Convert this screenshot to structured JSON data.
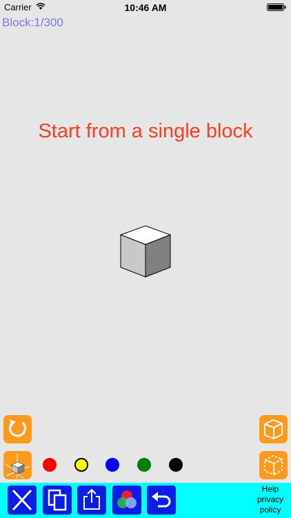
{
  "status_bar": {
    "carrier": "Carrier",
    "time": "10:46 AM"
  },
  "block_counter": "Block:1/300",
  "headline": "Start from a single block",
  "colors": {
    "accent": "#ff9a1f",
    "toolbar_bg": "#00ffff",
    "toolbar_button": "#0a1ee6",
    "headline": "#ff3b1f"
  },
  "palette": [
    {
      "name": "red",
      "color": "#ff0000",
      "selected": false
    },
    {
      "name": "yellow",
      "color": "#ffff00",
      "selected": true
    },
    {
      "name": "blue",
      "color": "#0000ff",
      "selected": false
    },
    {
      "name": "green",
      "color": "#008000",
      "selected": false
    },
    {
      "name": "black",
      "color": "#000000",
      "selected": false
    }
  ],
  "links": {
    "help": "Help",
    "privacy_line1": "privacy",
    "privacy_line2": "policy"
  },
  "icons": {
    "rotate": "rotate-icon",
    "view_cube": "cube-icon",
    "axes": "axes-cube-icon",
    "wireframe": "dashed-cube-icon",
    "delete": "x-icon",
    "copy": "copy-icon",
    "share": "share-icon",
    "color_mix": "color-mix-icon",
    "undo": "undo-icon"
  }
}
